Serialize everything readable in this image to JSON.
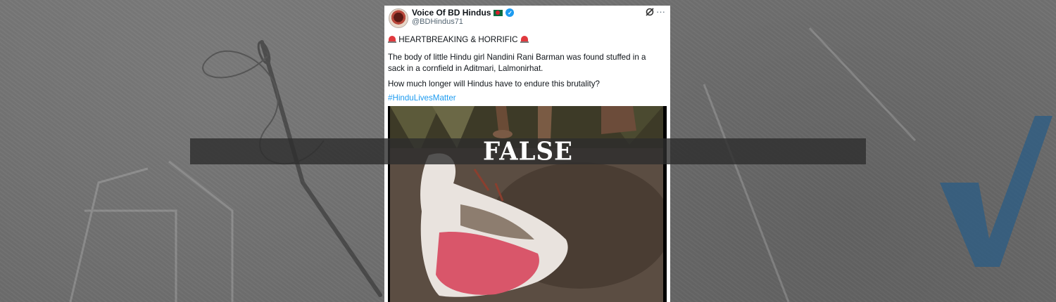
{
  "post": {
    "author_name": "Voice Of BD Hindus",
    "handle": "@BDHindus71",
    "headline": "HEARTBREAKING & HORRIFIC",
    "paragraph_1_line_1": "The body of little Hindu girl Nandini Rani Barman was found stuffed in a",
    "paragraph_1_line_2": "sack in a cornfield in Aditmari, Lalmonirhat.",
    "paragraph_2": "How much longer will Hindus have to endure this brutality?",
    "hashtag": "#HinduLivesMatter",
    "more_icon": "···"
  },
  "verdict": {
    "label": "FALSE"
  },
  "colors": {
    "background": "#6f6f6f",
    "link": "#1d9bf0",
    "banner": "#2d2d2d",
    "check_blue": "#2a5c86"
  },
  "icons": [
    "avatar",
    "bangladesh-flag-icon",
    "verified-badge-icon",
    "grok-icon",
    "more-icon",
    "siren-icon",
    "needle-icon",
    "checkmark-icon"
  ]
}
